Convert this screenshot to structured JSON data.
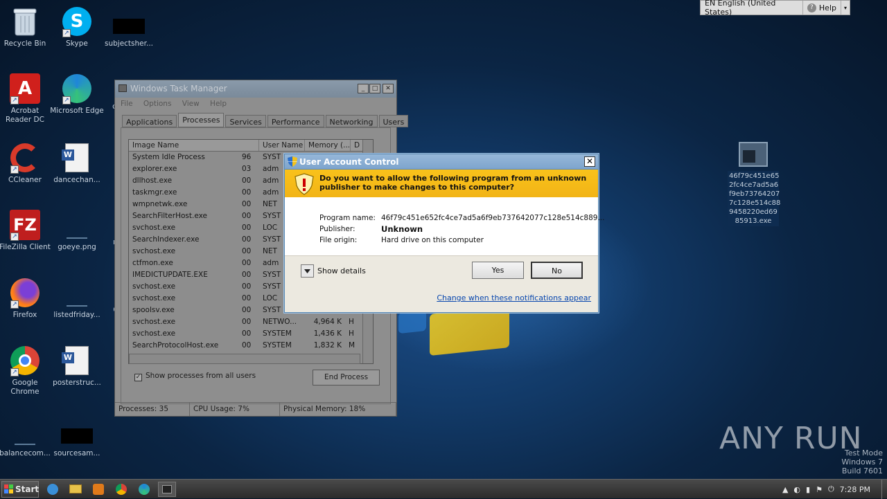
{
  "desktop_icons": [
    {
      "label": "Recycle Bin",
      "icon": "recycle-bin-icon"
    },
    {
      "label": "Skype",
      "icon": "skype-icon"
    },
    {
      "label": "subjectsher...",
      "icon": "black-thumbnail-icon"
    },
    {
      "label": "Acrobat Reader DC",
      "icon": "acrobat-icon"
    },
    {
      "label": "Microsoft Edge",
      "icon": "edge-icon"
    },
    {
      "label": "cus",
      "icon": "file-icon"
    },
    {
      "label": "CCleaner",
      "icon": "ccleaner-icon"
    },
    {
      "label": "dancechan...",
      "icon": "word-doc-icon"
    },
    {
      "label": "a",
      "icon": "file-icon"
    },
    {
      "label": "FileZilla Client",
      "icon": "filezilla-icon"
    },
    {
      "label": "goeye.png",
      "icon": "image-file-icon"
    },
    {
      "label": "rer",
      "icon": "file-icon"
    },
    {
      "label": "Firefox",
      "icon": "firefox-icon"
    },
    {
      "label": "listedfriday...",
      "icon": "blank-file-icon"
    },
    {
      "label": "Ge",
      "icon": "file-icon"
    },
    {
      "label": "Google Chrome",
      "icon": "chrome-icon"
    },
    {
      "label": "posterstruc...",
      "icon": "word-doc-icon"
    },
    {
      "label": "balancecom...",
      "icon": "blank-file-icon"
    },
    {
      "label": "sourcesam...",
      "icon": "black-thumbnail-icon"
    }
  ],
  "right_file": {
    "label": "46f79c451e652fc4ce7ad5a6f9eb737642077c128e514c889458220ed6985913.exe",
    "lines": [
      "46f79c451e65",
      "2fc4ce7ad5a6",
      "f9eb73764207",
      "7c128e514c88",
      "9458220ed69",
      "85913.exe"
    ]
  },
  "lang_bar": {
    "language": "EN English (United States)",
    "help": "Help"
  },
  "task_manager": {
    "title": "Windows Task Manager",
    "menu": [
      "File",
      "Options",
      "View",
      "Help"
    ],
    "tabs": [
      "Applications",
      "Processes",
      "Services",
      "Performance",
      "Networking",
      "Users"
    ],
    "active_tab": "Processes",
    "columns": [
      "Image Name",
      "User Name",
      "Memory (...",
      "D"
    ],
    "rows": [
      {
        "name": "System Idle Process",
        "pid": "96",
        "user": "SYST",
        "mem": "",
        "d": ""
      },
      {
        "name": "explorer.exe",
        "pid": "03",
        "user": "adm",
        "mem": "",
        "d": ""
      },
      {
        "name": "dllhost.exe",
        "pid": "00",
        "user": "adm",
        "mem": "",
        "d": ""
      },
      {
        "name": "taskmgr.exe",
        "pid": "00",
        "user": "adm",
        "mem": "",
        "d": ""
      },
      {
        "name": "wmpnetwk.exe",
        "pid": "00",
        "user": "NET",
        "mem": "",
        "d": ""
      },
      {
        "name": "SearchFilterHost.exe",
        "pid": "00",
        "user": "SYST",
        "mem": "",
        "d": ""
      },
      {
        "name": "svchost.exe",
        "pid": "00",
        "user": "LOC",
        "mem": "",
        "d": ""
      },
      {
        "name": "SearchIndexer.exe",
        "pid": "00",
        "user": "SYST",
        "mem": "",
        "d": ""
      },
      {
        "name": "svchost.exe",
        "pid": "00",
        "user": "NET",
        "mem": "",
        "d": ""
      },
      {
        "name": "ctfmon.exe",
        "pid": "00",
        "user": "adm",
        "mem": "",
        "d": ""
      },
      {
        "name": "IMEDICTUPDATE.EXE",
        "pid": "00",
        "user": "SYST",
        "mem": "",
        "d": ""
      },
      {
        "name": "svchost.exe",
        "pid": "00",
        "user": "SYST",
        "mem": "",
        "d": ""
      },
      {
        "name": "svchost.exe",
        "pid": "00",
        "user": "LOC",
        "mem": "",
        "d": ""
      },
      {
        "name": "spoolsv.exe",
        "pid": "00",
        "user": "SYST",
        "mem": "",
        "d": ""
      },
      {
        "name": "svchost.exe",
        "pid": "00",
        "user": "NETWO...",
        "mem": "4,964 K",
        "d": "H"
      },
      {
        "name": "svchost.exe",
        "pid": "00",
        "user": "SYSTEM",
        "mem": "1,436 K",
        "d": "H"
      },
      {
        "name": "SearchProtocolHost.exe",
        "pid": "00",
        "user": "SYSTEM",
        "mem": "1,832 K",
        "d": "M"
      }
    ],
    "show_all_label": "Show processes from all users",
    "end_process": "End Process",
    "status": {
      "processes": "Processes: 35",
      "cpu": "CPU Usage: 7%",
      "memory": "Physical Memory: 18%"
    }
  },
  "uac": {
    "title": "User Account Control",
    "question": "Do you want to allow the following program from an unknown publisher to make changes to this computer?",
    "program_label": "Program name:",
    "program_value": "46f79c451e652fc4ce7ad5a6f9eb737642077c128e514c889...",
    "publisher_label": "Publisher:",
    "publisher_value": "Unknown",
    "origin_label": "File origin:",
    "origin_value": "Hard drive on this computer",
    "show_details": "Show details",
    "yes": "Yes",
    "no": "No",
    "change_link": "Change when these notifications appear"
  },
  "watermark": {
    "brand": "ANY RUN",
    "test_mode": "Test Mode",
    "os": "Windows 7",
    "build": "Build 7601"
  },
  "taskbar": {
    "start": "Start",
    "time": "7:28 PM"
  }
}
